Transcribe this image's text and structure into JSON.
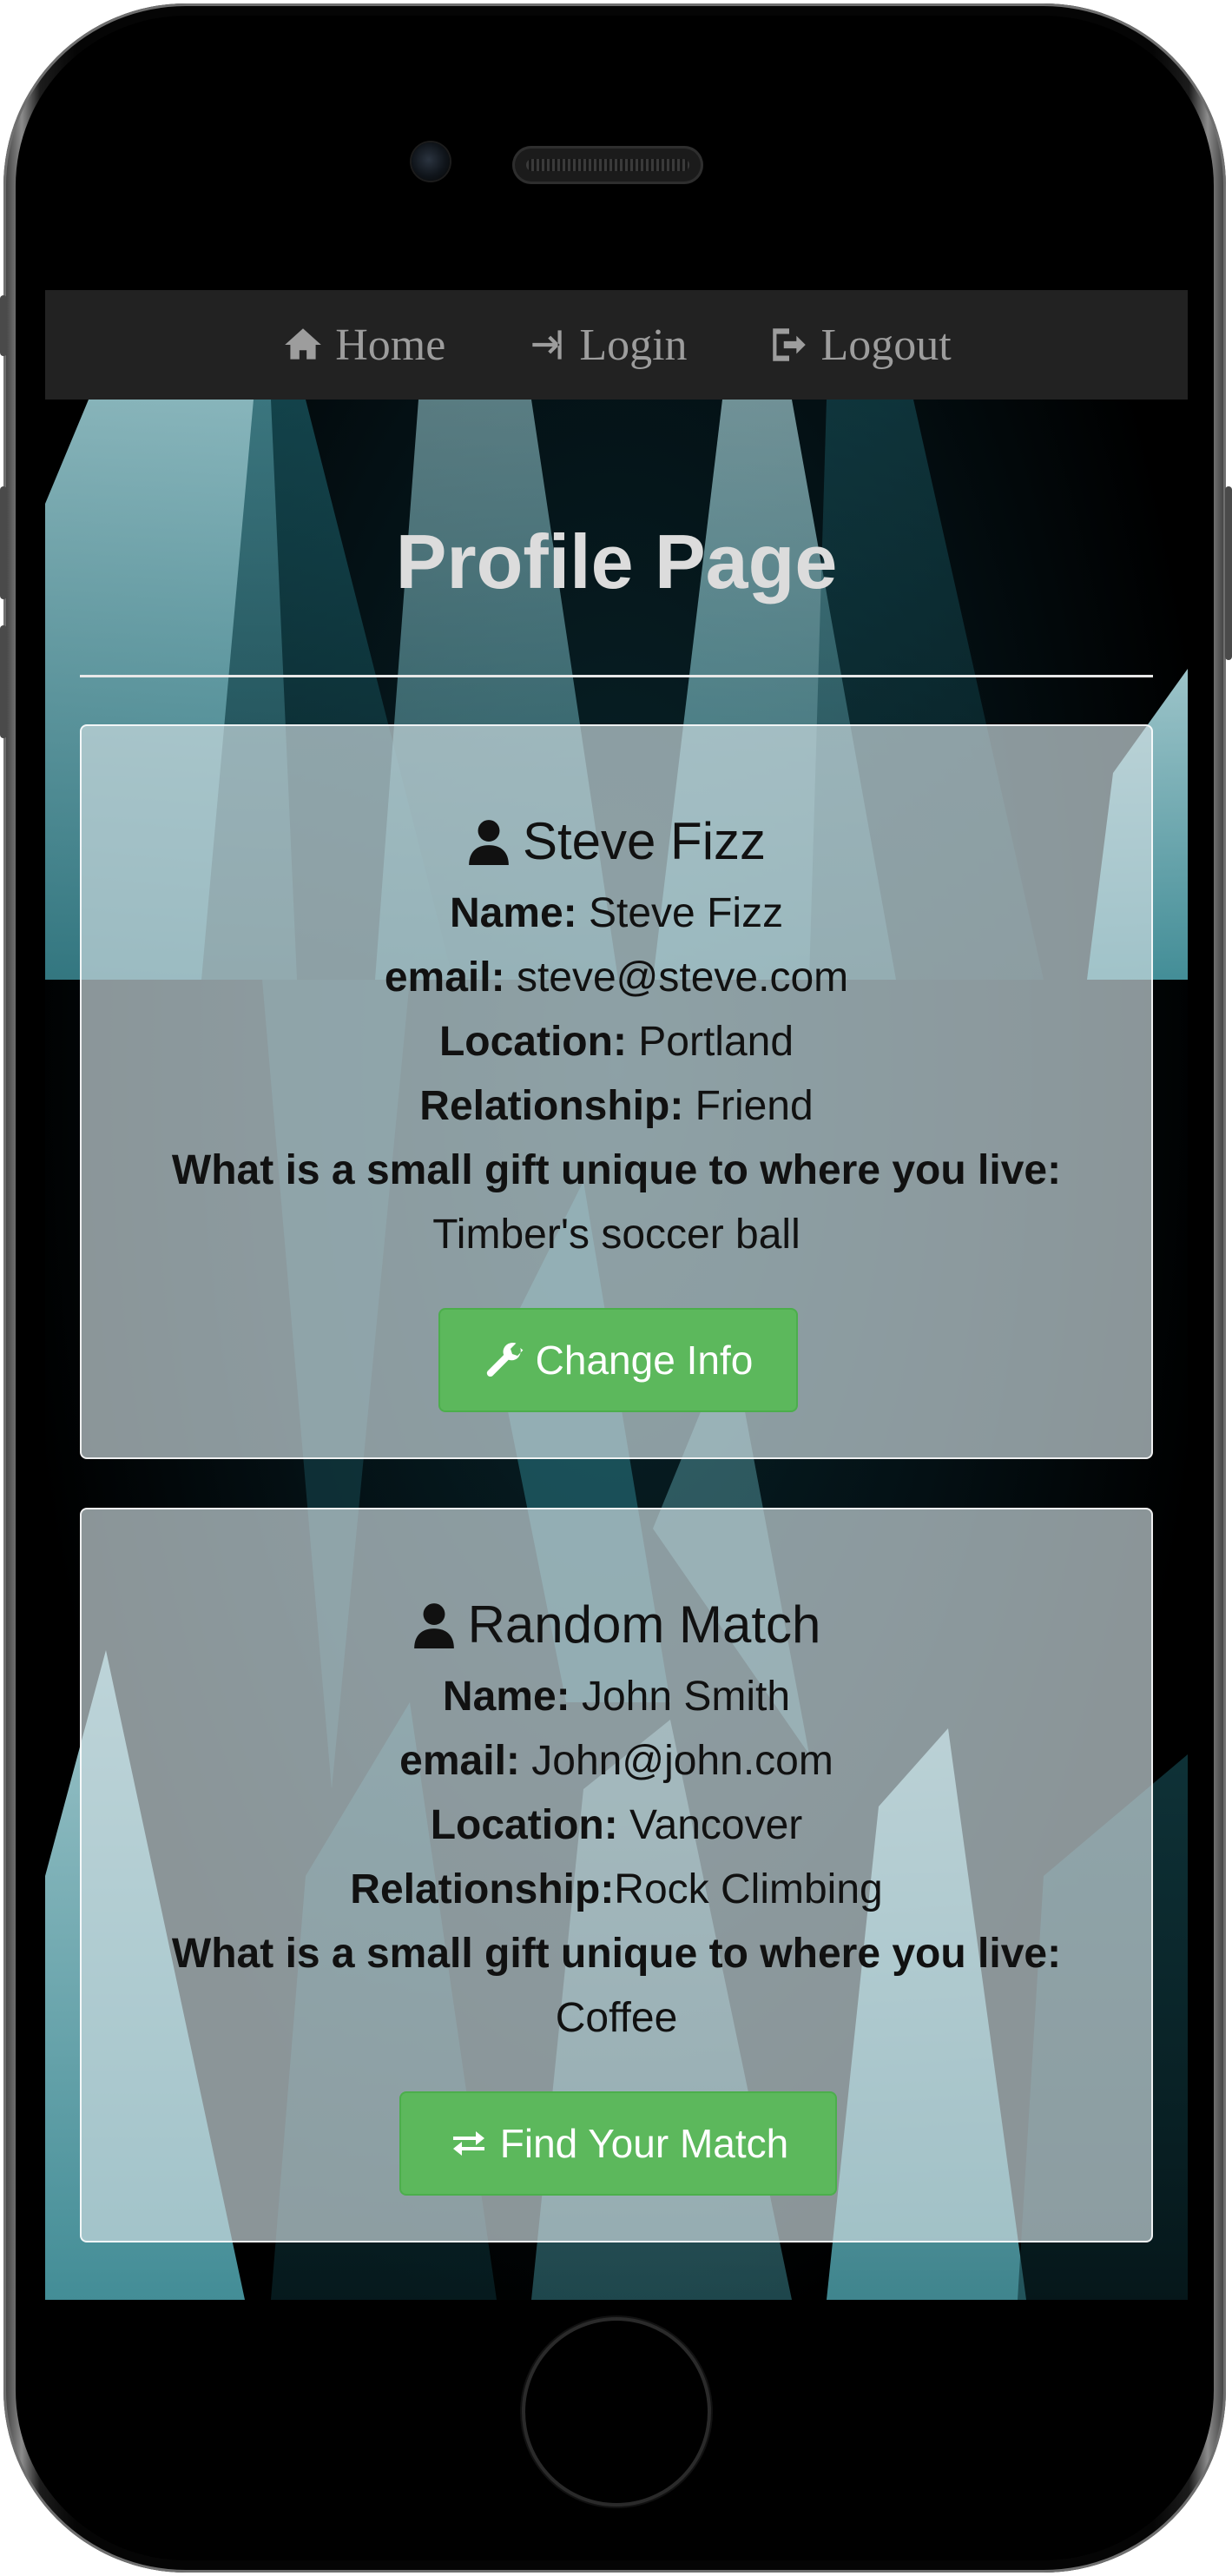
{
  "navbar": {
    "items": [
      {
        "label": "Home",
        "icon": "home-icon"
      },
      {
        "label": "Login",
        "icon": "login-icon"
      },
      {
        "label": "Logout",
        "icon": "logout-icon"
      }
    ]
  },
  "page": {
    "title": "Profile Page"
  },
  "profile_card": {
    "heading": "Steve Fizz",
    "icon": "user-icon",
    "fields": [
      {
        "label": "Name",
        "sep": ": ",
        "value": "Steve Fizz"
      },
      {
        "label": "email",
        "sep": ": ",
        "value": "steve@steve.com"
      },
      {
        "label": "Location",
        "sep": ": ",
        "value": "Portland"
      },
      {
        "label": "Relationship",
        "sep": ": ",
        "value": "Friend"
      }
    ],
    "gift_question": "What is a small gift unique to where you live",
    "gift_answer": "Timber's soccer ball",
    "button_label": "Change Info",
    "button_icon": "wrench-icon"
  },
  "match_card": {
    "heading": "Random Match",
    "icon": "user-icon",
    "fields": [
      {
        "label": "Name",
        "sep": ": ",
        "value": "John Smith"
      },
      {
        "label": "email",
        "sep": ": ",
        "value": "John@john.com"
      },
      {
        "label": "Location",
        "sep": ": ",
        "value": "Vancover"
      },
      {
        "label": "Relationship",
        "sep": ":",
        "value": "Rock Climbing"
      }
    ],
    "gift_question": "What is a small gift unique to where you live",
    "gift_answer": "Coffee",
    "button_label": "Find Your Match",
    "button_icon": "swap-arrows-icon"
  },
  "colors": {
    "navbar_bg": "#222222",
    "navbar_text": "#9d9d9d",
    "button_green": "#5cb85c",
    "card_bg": "#cddce0"
  }
}
